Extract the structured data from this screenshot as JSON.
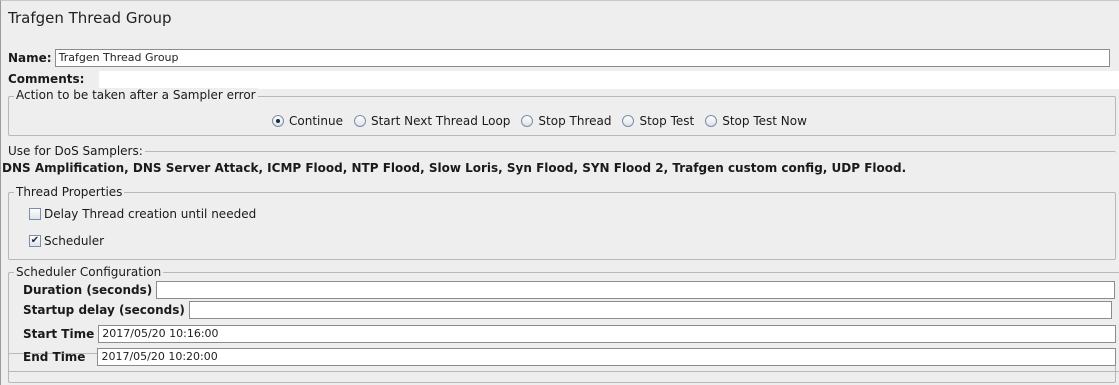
{
  "title": "Trafgen Thread Group",
  "name": {
    "label": "Name:",
    "value": "Trafgen Thread Group"
  },
  "comments": {
    "label": "Comments:",
    "value": ""
  },
  "sampler_error": {
    "legend": "Action to be taken after a Sampler error",
    "options": [
      {
        "label": "Continue",
        "selected": true
      },
      {
        "label": "Start Next Thread Loop",
        "selected": false
      },
      {
        "label": "Stop Thread",
        "selected": false
      },
      {
        "label": "Stop Test",
        "selected": false
      },
      {
        "label": "Stop Test Now",
        "selected": false
      }
    ]
  },
  "dos": {
    "legend": "Use for DoS Samplers:",
    "text": "DNS Amplification, DNS Server Attack, ICMP Flood, NTP Flood, Slow Loris, Syn Flood, SYN Flood 2, Trafgen custom config, UDP Flood."
  },
  "thread_props": {
    "legend": "Thread Properties",
    "delay_label": "Delay Thread creation until needed",
    "delay_checked": false,
    "scheduler_label": "Scheduler",
    "scheduler_checked": true
  },
  "scheduler": {
    "legend": "Scheduler Configuration",
    "duration_label": "Duration (seconds)",
    "duration_value": "",
    "startup_label": "Startup delay (seconds)",
    "startup_value": "",
    "start_label": "Start Time",
    "start_value": "2017/05/20 10:16:00",
    "end_label": "End Time",
    "end_value": "2017/05/20 10:20:00"
  }
}
